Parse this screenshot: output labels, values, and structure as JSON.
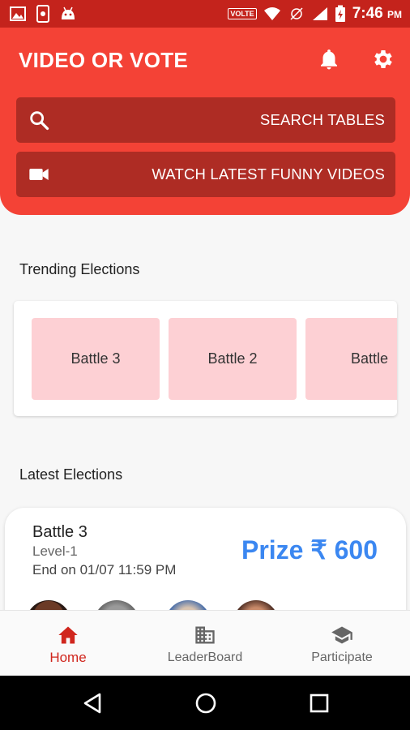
{
  "status_bar": {
    "volte": "VOLTE",
    "time": "7:46",
    "ampm": "PM"
  },
  "header": {
    "title": "VIDEO OR VOTE",
    "search_label": "SEARCH TABLES",
    "videos_label": "WATCH LATEST FUNNY VIDEOS"
  },
  "trending": {
    "title": "Trending Elections",
    "items": [
      {
        "label": "Battle 3"
      },
      {
        "label": "Battle 2"
      },
      {
        "label": "Battle"
      }
    ]
  },
  "latest": {
    "title": "Latest Elections",
    "card": {
      "name": "Battle 3",
      "level": "Level-1",
      "end": "End on  01/07 11:59 PM",
      "prize": "Prize ₹ 600"
    }
  },
  "bottom_nav": {
    "items": [
      {
        "label": "Home",
        "active": true
      },
      {
        "label": "LeaderBoard",
        "active": false
      },
      {
        "label": "Participate",
        "active": false
      }
    ]
  },
  "colors": {
    "primary": "#f44236",
    "status_bar": "#c4231c",
    "action_bar": "#ae2c24",
    "tile": "#fdd0d4",
    "prize": "#3b87f1",
    "active_nav": "#d0261d"
  },
  "icons": {
    "notification": "bell-icon",
    "settings": "gear-icon",
    "search": "search-icon",
    "video": "video-camera-icon",
    "home": "home-icon",
    "leaderboard": "building-icon",
    "participate": "graduation-cap-icon"
  }
}
